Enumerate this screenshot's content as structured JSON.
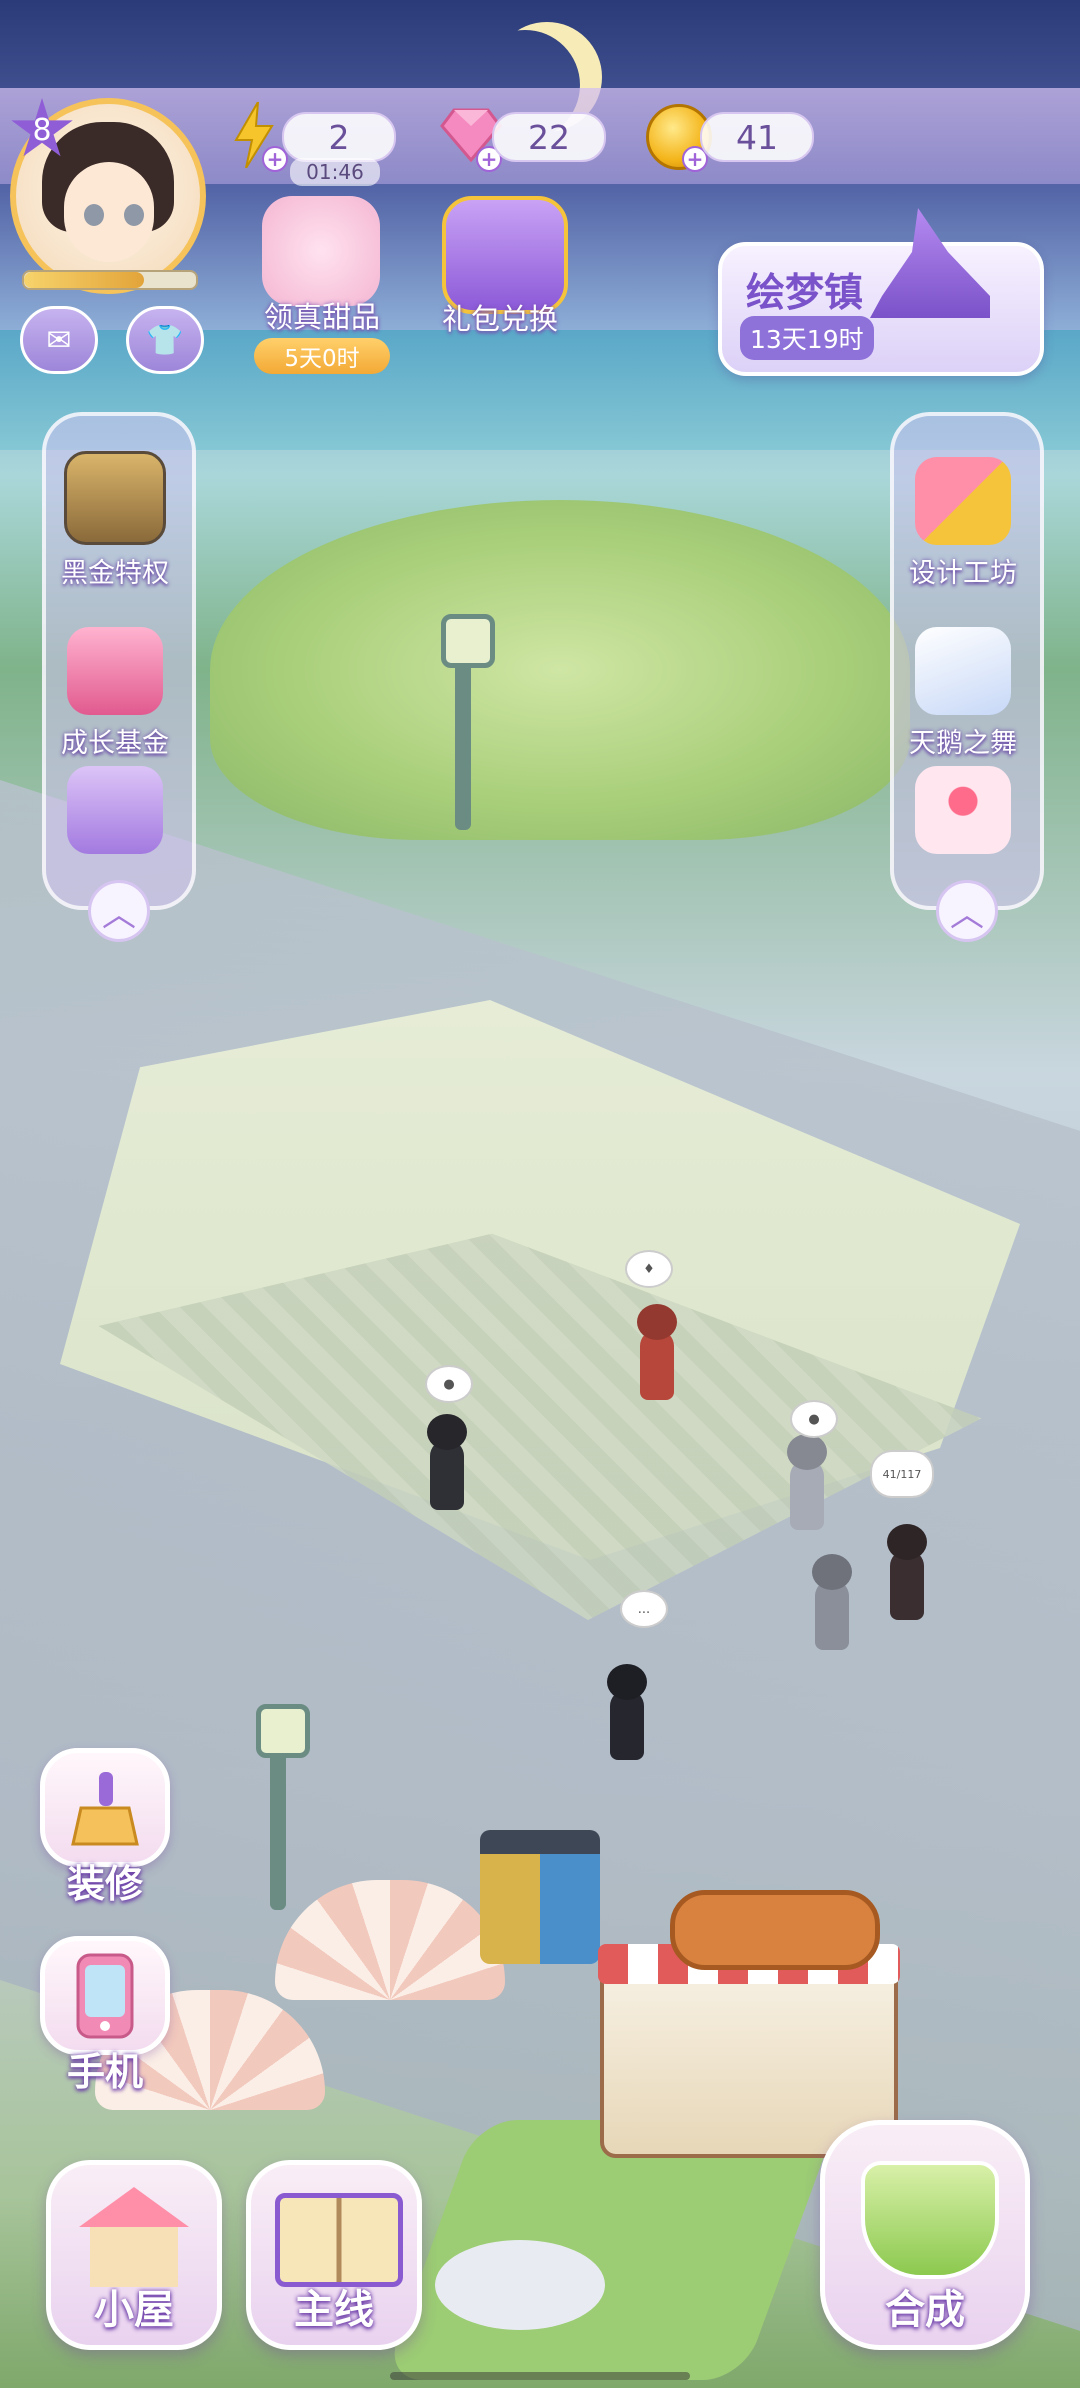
{
  "resources": {
    "energy": "2",
    "energy_timer": "01:46",
    "gems": "22",
    "coins": "41"
  },
  "player": {
    "level": "8"
  },
  "events": {
    "dessert_label": "领真甜品",
    "dessert_countdown": "5天0时",
    "gift_label": "礼包兑换"
  },
  "town": {
    "name": "绘梦镇",
    "time_left": "13天19时"
  },
  "left_panel": {
    "items": [
      {
        "label": "黑金特权",
        "icon": "vip-card-icon"
      },
      {
        "label": "成长基金",
        "icon": "gift-box-icon"
      },
      {
        "label": "",
        "icon": "cat-gift-icon"
      }
    ]
  },
  "right_panel": {
    "items": [
      {
        "label": "设计工坊",
        "icon": "ruler-pencil-icon"
      },
      {
        "label": "天鹅之舞",
        "icon": "feather-icon"
      },
      {
        "label": "",
        "icon": "cake-icon"
      }
    ]
  },
  "actions": {
    "decorate": "装修",
    "phone": "手机"
  },
  "bottom_nav": {
    "house": "小屋",
    "main_story": "主线",
    "merge": "合成"
  },
  "scene": {
    "bubble_dots": "...",
    "bubble_count": "41/117"
  },
  "colors": {
    "accent_purple": "#8f5ed6",
    "coin_gold": "#f4b51b",
    "gem_pink": "#f06fa8",
    "countdown_orange": "#f3a935"
  }
}
